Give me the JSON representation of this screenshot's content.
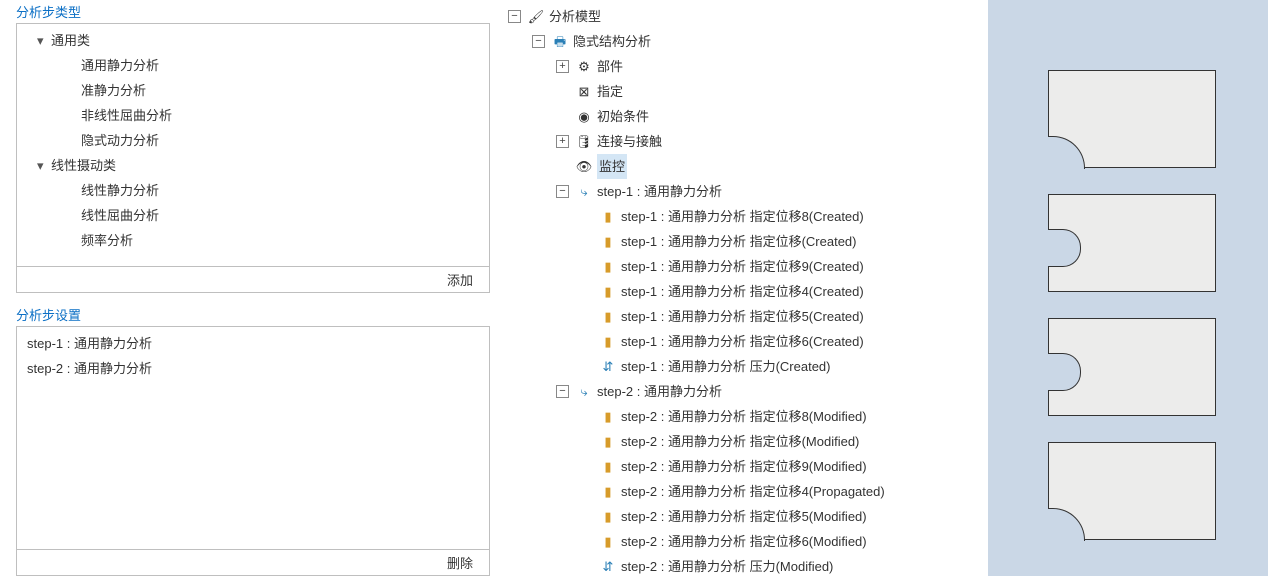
{
  "left": {
    "section_step_type": "分析步类型",
    "section_step_set": "分析步设置",
    "add_label": "添加",
    "del_label": "删除",
    "categories": [
      {
        "name": "通用类",
        "children": [
          "通用静力分析",
          "准静力分析",
          "非线性屈曲分析",
          "隐式动力分析"
        ]
      },
      {
        "name": "线性摄动类",
        "children": [
          "线性静力分析",
          "线性屈曲分析",
          "频率分析"
        ]
      }
    ],
    "steps": [
      "step-1 : 通用静力分析",
      "step-2 : 通用静力分析"
    ]
  },
  "tree": {
    "root": "分析模型",
    "analysis": "隐式结构分析",
    "parts": "部件",
    "assign": "指定",
    "initial": "初始条件",
    "contact": "连接与接触",
    "monitor": "监控",
    "step1": {
      "label": "step-1 : 通用静力分析",
      "children": [
        "step-1 : 通用静力分析 指定位移8(Created)",
        "step-1 : 通用静力分析 指定位移(Created)",
        "step-1 : 通用静力分析 指定位移9(Created)",
        "step-1 : 通用静力分析 指定位移4(Created)",
        "step-1 : 通用静力分析 指定位移5(Created)",
        "step-1 : 通用静力分析 指定位移6(Created)",
        "step-1 : 通用静力分析 压力(Created)"
      ]
    },
    "step2": {
      "label": "step-2 : 通用静力分析",
      "children": [
        "step-2 : 通用静力分析 指定位移8(Modified)",
        "step-2 : 通用静力分析 指定位移(Modified)",
        "step-2 : 通用静力分析 指定位移9(Modified)",
        "step-2 : 通用静力分析 指定位移4(Propagated)",
        "step-2 : 通用静力分析 指定位移5(Modified)",
        "step-2 : 通用静力分析 指定位移6(Modified)",
        "step-2 : 通用静力分析 压力(Modified)"
      ]
    }
  },
  "icons": {
    "model": "🖌",
    "analysis": "🖶",
    "parts": "⚙",
    "assign": "⊠",
    "initial": "◉",
    "contact": "🛢",
    "monitor": "👁",
    "step": "⤷",
    "disp": "▮",
    "press": "⇵"
  },
  "colors": {
    "disp_icon_fg": "#2a7fb6",
    "disp_icon_acc": "#d79b2a",
    "press_icon": "#2a7fb6",
    "tree_hl_bg": "#d4e6f5",
    "viewport_bg": "#cad7e6"
  }
}
